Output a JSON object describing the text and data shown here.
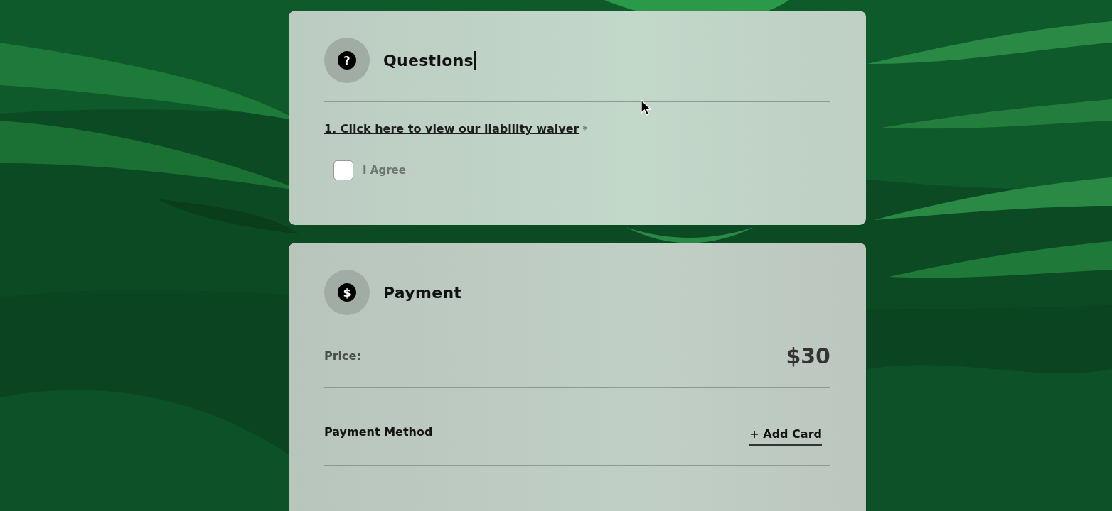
{
  "questions": {
    "icon": "?",
    "title": "Questions",
    "items": [
      {
        "number": "1.",
        "link": "Click here to view our liability waiver",
        "required_mark": "*",
        "checkbox": {
          "label": "I Agree",
          "checked": false
        }
      }
    ]
  },
  "payment": {
    "icon": "$",
    "title": "Payment",
    "price_label": "Price:",
    "price": "$30",
    "method_label": "Payment Method",
    "add_card": "+ Add Card"
  }
}
